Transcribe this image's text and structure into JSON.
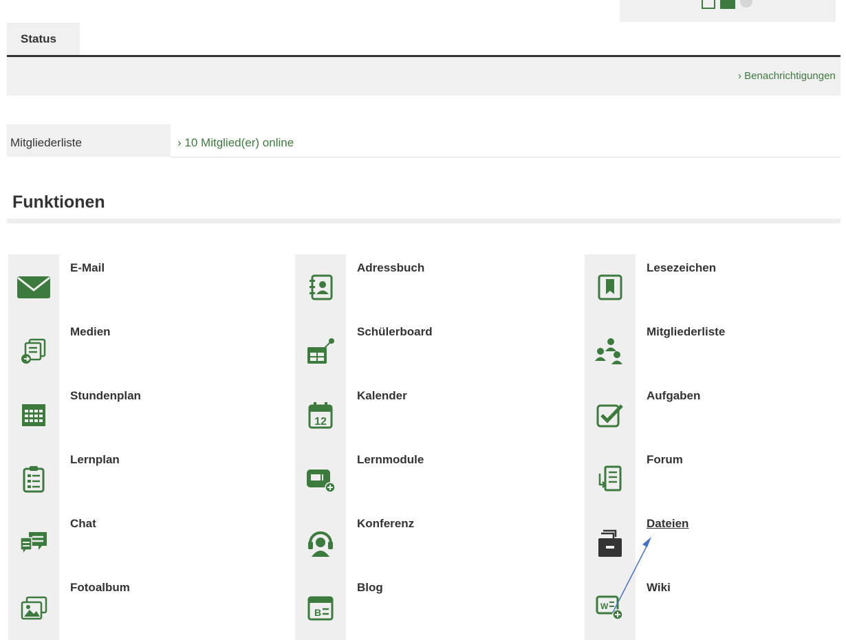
{
  "header": {
    "status_tab": "Status",
    "notifications_link": "Benachrichtigungen"
  },
  "members": {
    "label": "Mitgliederliste",
    "online_link": "10 Mitglied(er) online"
  },
  "functions": {
    "title": "Funktionen",
    "tiles": [
      {
        "label": "E-Mail",
        "icon": "envelope-icon"
      },
      {
        "label": "Adressbuch",
        "icon": "address-book-icon"
      },
      {
        "label": "Lesezeichen",
        "icon": "bookmark-icon"
      },
      {
        "label": "Medien",
        "icon": "media-icon"
      },
      {
        "label": "Schülerboard",
        "icon": "pinboard-icon"
      },
      {
        "label": "Mitgliederliste",
        "icon": "members-icon"
      },
      {
        "label": "Stundenplan",
        "icon": "timetable-icon"
      },
      {
        "label": "Kalender",
        "icon": "calendar-icon"
      },
      {
        "label": "Aufgaben",
        "icon": "checkbox-icon"
      },
      {
        "label": "Lernplan",
        "icon": "clipboard-icon"
      },
      {
        "label": "Lernmodule",
        "icon": "learning-module-icon"
      },
      {
        "label": "Forum",
        "icon": "forum-icon"
      },
      {
        "label": "Chat",
        "icon": "chat-icon"
      },
      {
        "label": "Konferenz",
        "icon": "headset-icon"
      },
      {
        "label": "Dateien",
        "icon": "file-cabinet-icon"
      },
      {
        "label": "Fotoalbum",
        "icon": "photo-album-icon"
      },
      {
        "label": "Blog",
        "icon": "blog-icon"
      },
      {
        "label": "Wiki",
        "icon": "wiki-icon"
      }
    ]
  },
  "calendar_day": "12",
  "colors": {
    "accent_green": "#3d7a3d",
    "files_icon_dark": "#333333"
  }
}
